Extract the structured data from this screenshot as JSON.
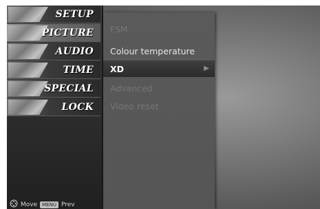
{
  "side_menu": [
    {
      "label": "SETUP"
    },
    {
      "label": "PICTURE"
    },
    {
      "label": "AUDIO"
    },
    {
      "label": "TIME"
    },
    {
      "label": "SPECIAL"
    },
    {
      "label": "LOCK"
    }
  ],
  "selected_side_item": "PICTURE",
  "help": {
    "move_label": "Move",
    "menu_key": "MENU",
    "prev_label": "Prev"
  },
  "submenu": [
    {
      "label": "FSM",
      "state": "dim"
    },
    {
      "label": "Colour temperature",
      "state": "normal"
    },
    {
      "label": "XD",
      "state": "selected"
    },
    {
      "label": "Advanced",
      "state": "dim"
    },
    {
      "label": "Video reset",
      "state": "dim"
    }
  ],
  "icons": {
    "submenu_arrow": "right-triangle-icon",
    "move_hint": "navigation-pad-icon"
  },
  "colors": {
    "selected_bg": "#2c2c2c",
    "submenu_bg": "#5a5a5a",
    "side_bg": "#2b2b2b"
  }
}
